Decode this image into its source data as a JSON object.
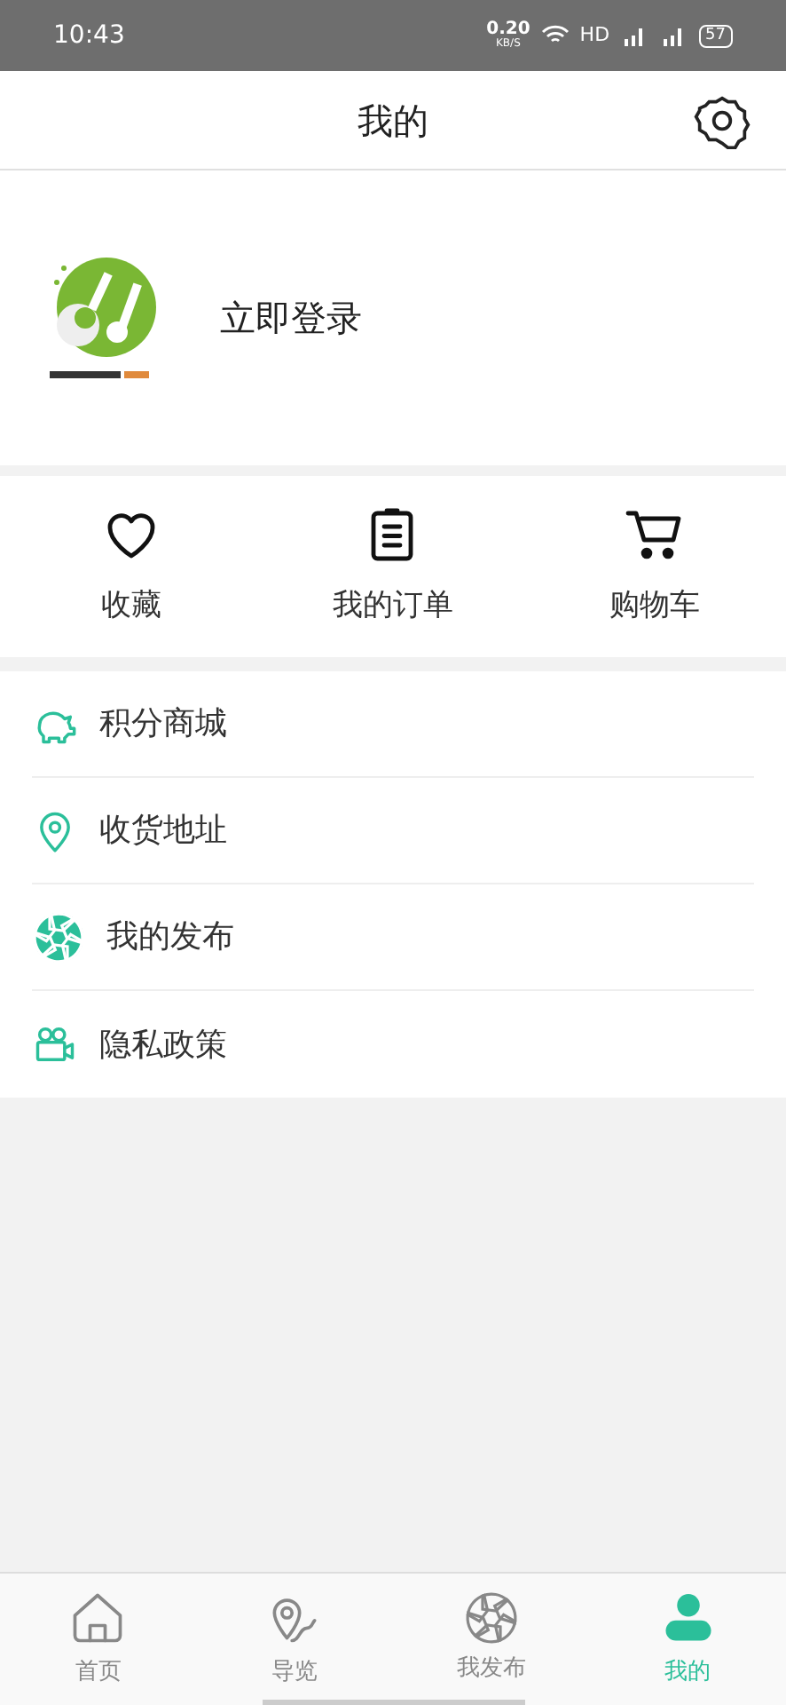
{
  "status_bar": {
    "time": "10:43",
    "speed": "0.20",
    "speed_unit": "KB/S",
    "hd": "HD",
    "battery": "57"
  },
  "header": {
    "title": "我的"
  },
  "profile": {
    "login": "立即登录"
  },
  "quick_actions": [
    {
      "kind": "heart",
      "label": "收藏"
    },
    {
      "kind": "clipboard",
      "label": "我的订单"
    },
    {
      "kind": "cart",
      "label": "购物车"
    }
  ],
  "menu": [
    {
      "kind": "piggy",
      "label": "积分商城"
    },
    {
      "kind": "pin",
      "label": "收货地址"
    },
    {
      "kind": "aperture",
      "label": "我的发布"
    },
    {
      "kind": "camera",
      "label": "隐私政策"
    }
  ],
  "tabs": [
    {
      "kind": "home",
      "label": "首页",
      "selected": false
    },
    {
      "kind": "map",
      "label": "导览",
      "selected": false
    },
    {
      "kind": "aperture",
      "label": "我发布",
      "selected": false
    },
    {
      "kind": "user",
      "label": "我的",
      "selected": true
    }
  ]
}
